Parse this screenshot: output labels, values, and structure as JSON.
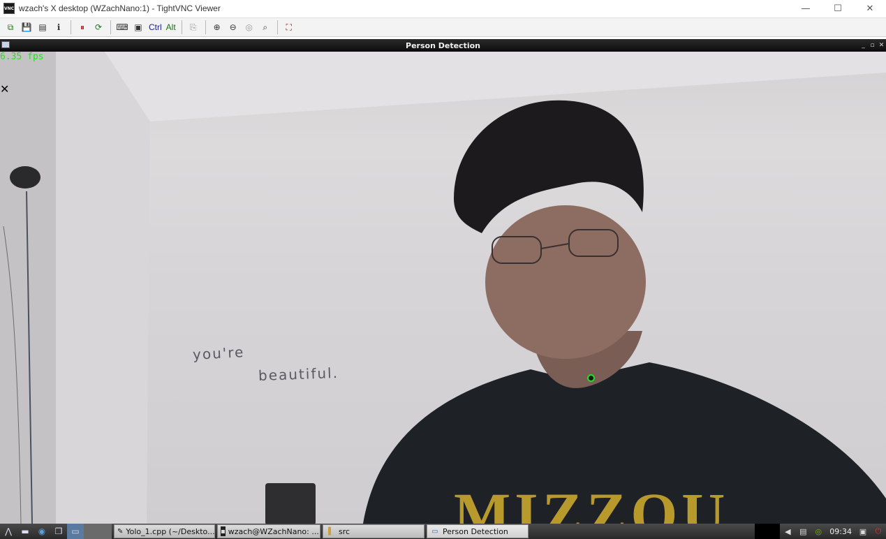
{
  "window": {
    "title": "wzach's X desktop (WZachNano:1) - TightVNC Viewer",
    "icon": "VNC",
    "minimize_glyph": "—",
    "maximize_glyph": "☐",
    "close_glyph": "✕"
  },
  "toolbar": {
    "buttons": [
      {
        "icon": "new-connection-icon",
        "glyph": "⧉"
      },
      {
        "icon": "save-icon",
        "glyph": "💾"
      },
      {
        "icon": "options-icon",
        "glyph": "▤"
      },
      {
        "icon": "info-icon",
        "glyph": "ℹ"
      },
      {
        "icon": "pause-icon",
        "glyph": "⏸"
      },
      {
        "icon": "refresh-icon",
        "glyph": "⟳"
      },
      {
        "icon": "ctrl-alt-del-icon",
        "glyph": "⌨"
      },
      {
        "icon": "ctrl-esc-icon",
        "glyph": "▣"
      }
    ],
    "ctrl_label": "Ctrl",
    "alt_label": "Alt",
    "clipboard_glyph": "⎘",
    "zoom_in_glyph": "⊕",
    "zoom_out_glyph": "⊖",
    "zoom_100_glyph": "◎",
    "zoom_fit_glyph": "⌕",
    "fullscreen_glyph": "⛶"
  },
  "remote_window": {
    "title": "Person Detection",
    "controls": [
      "_",
      "▫",
      "✕"
    ]
  },
  "camera": {
    "fps_label": "6.35 fps",
    "close_glyph": "✕",
    "wall_text_line1": "you're",
    "wall_text_line2": "beautiful.",
    "shirt_text": "MIZZOU",
    "detection_color": "#22e022"
  },
  "taskbar": {
    "launcher_icons": [
      "menu-icon",
      "file-manager-icon",
      "browser-icon",
      "desktop-icon",
      "window-icon"
    ],
    "tasks": [
      {
        "label": "Yolo_1.cpp (~/Deskto...",
        "icon": "text-editor-icon"
      },
      {
        "label": "wzach@WZachNano: ...",
        "icon": "terminal-icon"
      },
      {
        "label": "src",
        "icon": "folder-icon"
      },
      {
        "label": "Person Detection",
        "icon": "window-icon"
      }
    ],
    "clock": "09:34"
  }
}
